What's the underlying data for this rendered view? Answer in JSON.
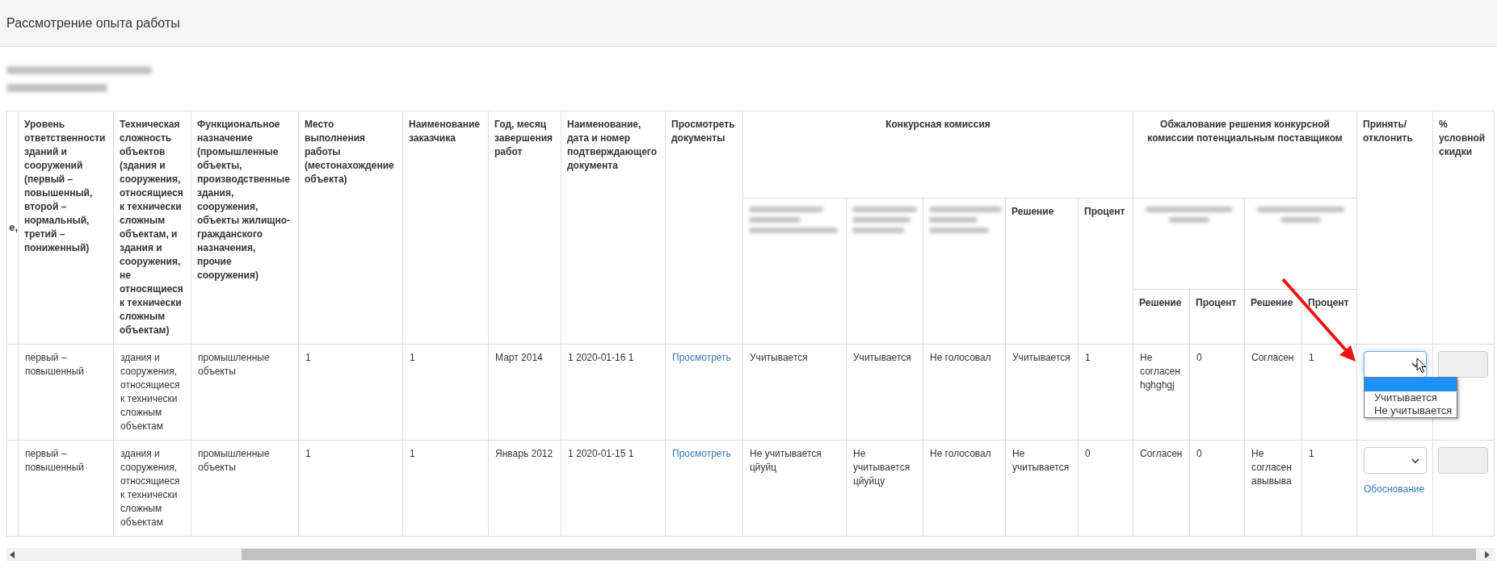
{
  "page": {
    "title": "Рассмотрение опыта работы"
  },
  "info_lines": [
    {
      "kind": "redacted"
    },
    {
      "kind": "redacted"
    }
  ],
  "table": {
    "leading_columns": [
      {
        "label": "е,"
      },
      {
        "label": "Уровень ответственности зданий и сооружений (первый – повышенный, второй – нормальный, третий – пониженный)"
      },
      {
        "label": "Техническая сложность объектов (здания и сооружения, относящиеся к технически сложным объектам, и здания и сооружения, не относящиеся к технически сложным объектам)"
      },
      {
        "label": "Функциональное назначение (промышленные объекты, производственные здания, сооружения, объекты жилищно-гражданского назначения, прочие сооружения)"
      },
      {
        "label": "Место выполнения работы (местонахождение объекта)"
      },
      {
        "label": "Наименование заказчика"
      },
      {
        "label": "Год, месяц завершения работ"
      },
      {
        "label": "Наименование, дата и номер подтверждающего документа"
      },
      {
        "label": "Просмотреть документы"
      }
    ],
    "commission": {
      "label": "Конкурсная комиссия",
      "subcolumns": [
        {
          "kind": "redacted"
        },
        {
          "kind": "redacted"
        },
        {
          "kind": "redacted"
        },
        {
          "kind": "label",
          "label": "Решение"
        },
        {
          "kind": "label",
          "label": "Процент"
        }
      ]
    },
    "appeal": {
      "label": "Обжалование решения конкурсной комиссии потенциальным поставщиком",
      "subgroups": [
        {
          "kind": "redacted",
          "subcolumns": [
            "Решение",
            "Процент"
          ]
        },
        {
          "kind": "redacted",
          "subcolumns": [
            "Решение",
            "Процент"
          ]
        }
      ]
    },
    "trailing_columns": [
      {
        "label": "Принять/ отклонить"
      },
      {
        "label": "% условной скидки"
      }
    ],
    "rows": [
      {
        "cells": [
          "первый – повышенный",
          "здания и сооружения, относящиеся к технически сложным объектам",
          "промышленные объекты",
          "1",
          "1",
          "Март 2014",
          "1 2020-01-16 1"
        ],
        "view_link": "Просмотреть",
        "commission": [
          "Учитывается",
          "Учитывается",
          "Не голосовал",
          "Учитывается",
          "1"
        ],
        "appeal": [
          "Не согласен hghghgj",
          "0",
          "Согласен",
          "1"
        ],
        "decision": {
          "expanded": true,
          "blank_option_highlighted": true,
          "options": [
            {
              "label": "Учитывается",
              "selected": false
            },
            {
              "label": "Не учитывается",
              "selected": false
            }
          ]
        },
        "discount": {
          "disabled": true
        }
      },
      {
        "cells": [
          "первый – повышенный",
          "здания и сооружения, относящиеся к технически сложным объектам",
          "промышленные объекты",
          "1",
          "1",
          "Январь 2012",
          "1 2020-01-15 1"
        ],
        "view_link": "Просмотреть",
        "commission": [
          "Не учитывается цйуйц",
          "Не учитывается цйуйцу",
          "Не голосовал",
          "Не учитывается",
          "0"
        ],
        "appeal": [
          "Согласен",
          "0",
          "Не согласен авывыва",
          "1"
        ],
        "decision": {
          "expanded": false
        },
        "justification_link": "Обоснование",
        "discount": {
          "disabled": true
        }
      }
    ]
  }
}
